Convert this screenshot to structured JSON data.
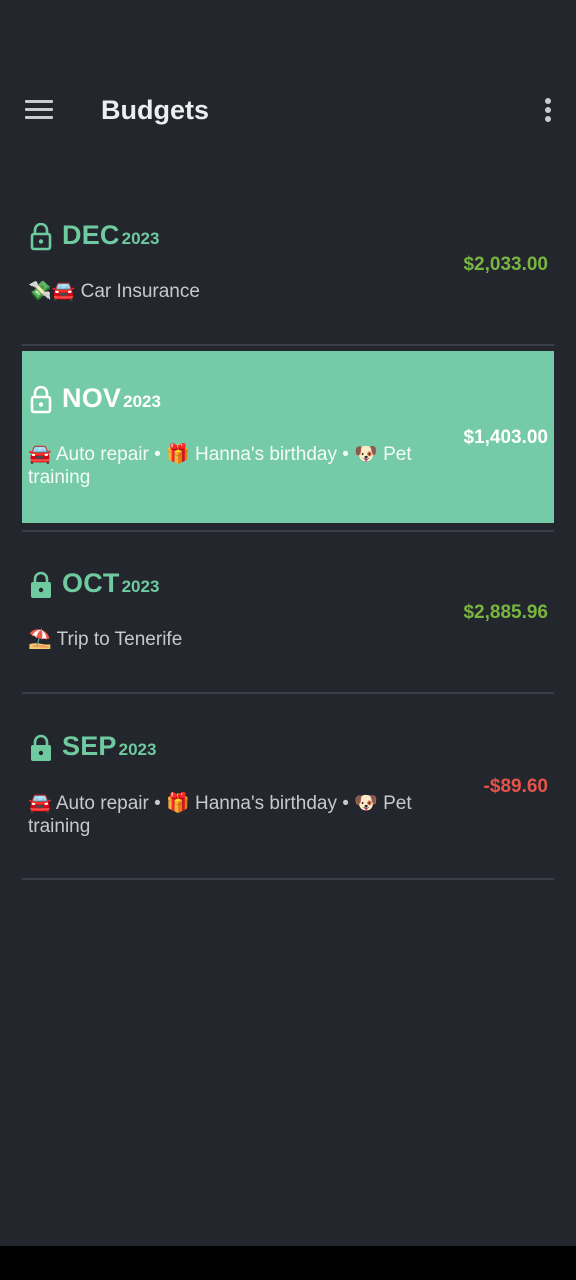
{
  "app_bar": {
    "title": "Budgets",
    "menu_icon": "hamburger-menu-icon",
    "overflow_icon": "more-vertical-icon"
  },
  "colors": {
    "background": "#23262d",
    "accent_green": "#6fcb9f",
    "selected_bg": "#75cba8",
    "positive_amount": "#78b63f",
    "negative_amount": "#e5534b"
  },
  "budgets": [
    {
      "month": "DEC",
      "year": "2023",
      "lock_icon": "lock-open-icon",
      "description": "💸🚘 Car Insurance",
      "amount": "$2,033.00",
      "selected": false
    },
    {
      "month": "NOV",
      "year": "2023",
      "lock_icon": "lock-open-icon",
      "description": "🚘 Auto repair • 🎁 Hanna's birthday • 🐶 Pet training",
      "amount": "$1,403.00",
      "selected": true
    },
    {
      "month": "OCT",
      "year": "2023",
      "lock_icon": "lock-closed-icon",
      "description": "⛱️ Trip to Tenerife",
      "amount": "$2,885.96",
      "selected": false
    },
    {
      "month": "SEP",
      "year": "2023",
      "lock_icon": "lock-closed-icon",
      "description": "🚘 Auto repair • 🎁 Hanna's birthday • 🐶 Pet training",
      "amount": "-$89.60",
      "selected": false
    }
  ]
}
